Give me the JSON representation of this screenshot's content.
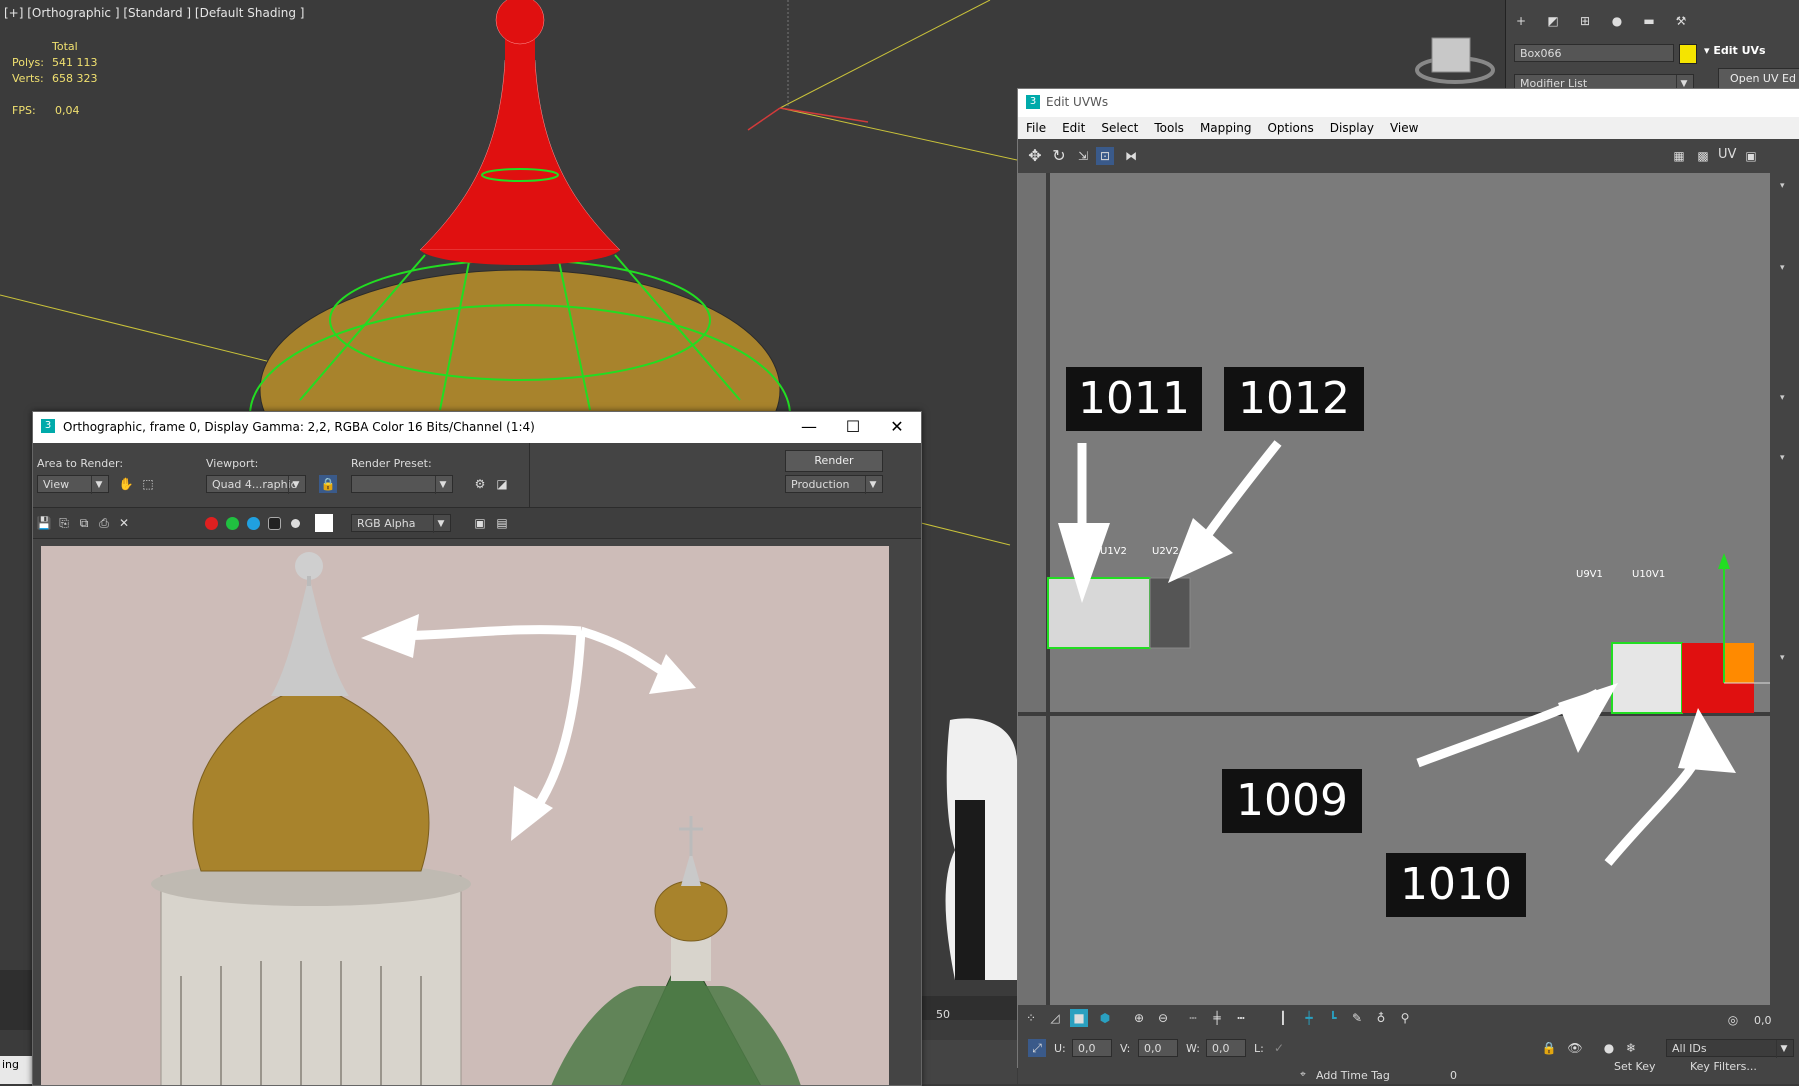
{
  "viewport": {
    "label": "[+] [Orthographic ] [Standard ] [Default Shading ]",
    "stats": {
      "total_label": "Total",
      "polys_label": "Polys:",
      "polys_value": "541 113",
      "verts_label": "Verts:",
      "verts_value": "658 323",
      "fps_label": "FPS:",
      "fps_value": "0,04"
    },
    "timeline_tick": "50",
    "bottom_left_text": "ing"
  },
  "command_panel": {
    "object_name": "Box066",
    "object_color": "#f5e400",
    "modifier_list": "Modifier List",
    "rollout_title": "Edit UVs",
    "open_uv_button": "Open UV Ed"
  },
  "render_frame": {
    "title": "Orthographic, frame 0, Display Gamma: 2,2, RGBA Color 16 Bits/Channel (1:4)",
    "area_to_render_label": "Area to Render:",
    "area_to_render_value": "View",
    "viewport_label": "Viewport:",
    "viewport_value": "Quad 4...raphic",
    "render_preset_label": "Render Preset:",
    "render_preset_value": "",
    "render_button": "Render",
    "production_value": "Production",
    "channel_value": "RGB Alpha"
  },
  "edit_uvws": {
    "title": "Edit UVWs",
    "menu": [
      "File",
      "Edit",
      "Select",
      "Tools",
      "Mapping",
      "Options",
      "Display",
      "View"
    ],
    "uv_label": "UV",
    "tiles": {
      "u1v2": "U1V2",
      "u2v2": "U2V2",
      "u9v1": "U9V1",
      "u10v1": "U10V1"
    },
    "callouts": [
      "1011",
      "1012",
      "1009",
      "1010"
    ],
    "u_label": "U:",
    "u_value": "0,0",
    "v_label": "V:",
    "v_value": "0,0",
    "w_label": "W:",
    "w_value": "0,0",
    "l_label": "L:",
    "ids_value": "All IDs",
    "spin_value": "0,0"
  },
  "status_bar": {
    "add_time_tag": "Add Time Tag",
    "set_key": "Set Key",
    "key_filters": "Key Filters...",
    "key_value": "0"
  },
  "colors": {
    "dome_gold": "#a8832c",
    "dome_green": "#4d7a47",
    "selection_red": "#e01010",
    "uv_green": "#22dd22",
    "render_bg": "#cdbcb8"
  }
}
